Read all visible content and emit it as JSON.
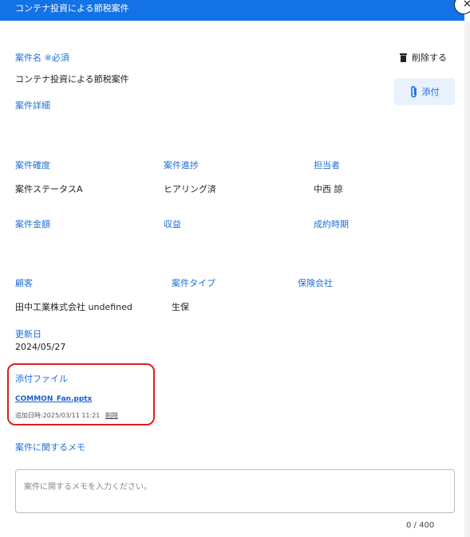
{
  "header": {
    "title": "コンテナ投資による節税案件"
  },
  "close_icon": "close-icon",
  "toolbar": {
    "delete_label": "削除する",
    "attach_label": "添付"
  },
  "fields": {
    "name": {
      "label": "案件名 ※必須",
      "value": "コンテナ投資による節税案件"
    },
    "detail": {
      "label": "案件詳細"
    },
    "certainty": {
      "label": "案件確度",
      "value": "案件ステータスA"
    },
    "progress": {
      "label": "案件進捗",
      "value": "ヒアリング済"
    },
    "owner": {
      "label": "担当者",
      "value": "中西 諒"
    },
    "amount": {
      "label": "案件金額"
    },
    "profit": {
      "label": "収益"
    },
    "close_date": {
      "label": "成約時期"
    },
    "customer": {
      "label": "顧客",
      "value": "田中工業株式会社 undefined"
    },
    "type": {
      "label": "案件タイプ",
      "value": "生保"
    },
    "insurer": {
      "label": "保険会社"
    },
    "updated": {
      "label": "更新日",
      "value": "2024/05/27"
    }
  },
  "attachments": {
    "label": "添付ファイル",
    "file_name": "COMMON_Fan.pptx",
    "added": "追加日時:2025/03/11 11:21",
    "delete_label": "削除"
  },
  "memo": {
    "label": "案件に関するメモ",
    "placeholder": "案件に関するメモを入力ください。",
    "counter": "0 / 400"
  },
  "colors": {
    "header": "#1272e6",
    "label": "#1f6fd6",
    "highlight": "#e11d1d"
  }
}
